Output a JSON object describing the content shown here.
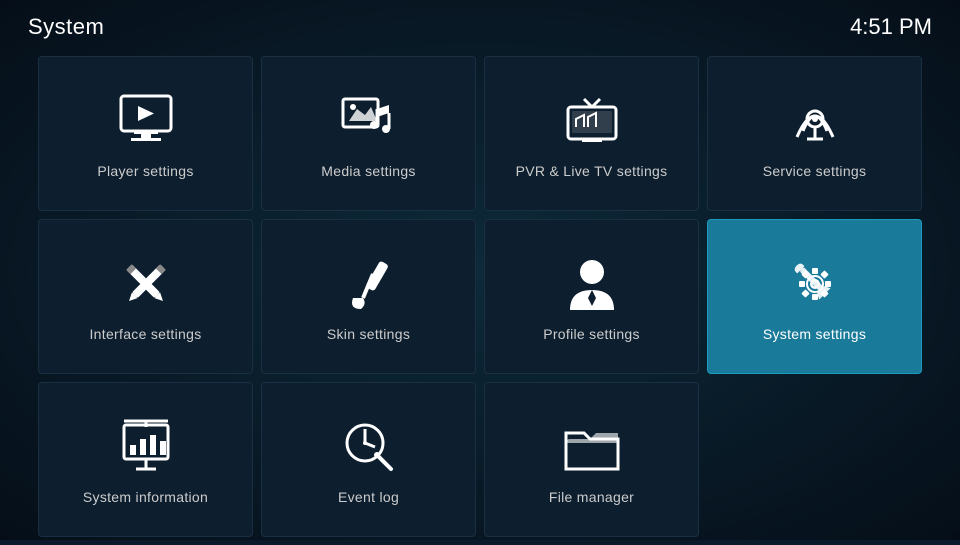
{
  "header": {
    "title": "System",
    "time": "4:51 PM"
  },
  "tiles": [
    {
      "id": "player-settings",
      "label": "Player settings",
      "icon": "player",
      "active": false
    },
    {
      "id": "media-settings",
      "label": "Media settings",
      "icon": "media",
      "active": false
    },
    {
      "id": "pvr-settings",
      "label": "PVR & Live TV settings",
      "icon": "pvr",
      "active": false
    },
    {
      "id": "service-settings",
      "label": "Service settings",
      "icon": "service",
      "active": false
    },
    {
      "id": "interface-settings",
      "label": "Interface settings",
      "icon": "interface",
      "active": false
    },
    {
      "id": "skin-settings",
      "label": "Skin settings",
      "icon": "skin",
      "active": false
    },
    {
      "id": "profile-settings",
      "label": "Profile settings",
      "icon": "profile",
      "active": false
    },
    {
      "id": "system-settings",
      "label": "System settings",
      "icon": "system",
      "active": true
    },
    {
      "id": "system-information",
      "label": "System information",
      "icon": "sysinfo",
      "active": false
    },
    {
      "id": "event-log",
      "label": "Event log",
      "icon": "eventlog",
      "active": false
    },
    {
      "id": "file-manager",
      "label": "File manager",
      "icon": "filemanager",
      "active": false
    }
  ]
}
